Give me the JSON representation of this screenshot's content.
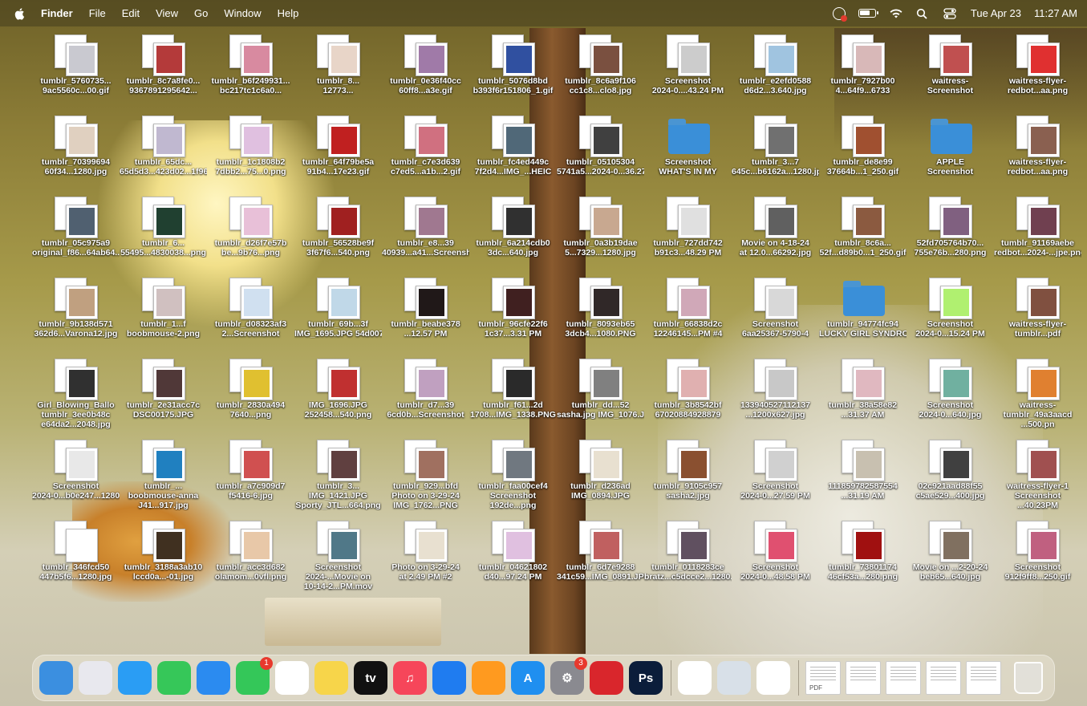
{
  "menubar": {
    "app_name": "Finder",
    "menus": [
      "File",
      "Edit",
      "View",
      "Go",
      "Window",
      "Help"
    ],
    "date": "Tue Apr 23",
    "time": "11:27 AM"
  },
  "desktop": {
    "items": [
      {
        "label": "tumblr_5760735...\n9ac5560c...00.gif",
        "color": "#c9c9d0"
      },
      {
        "label": "tumblr_8c7a8fe0...\n9367891295642...",
        "color": "#b43a3a"
      },
      {
        "label": "tumblr_b6f249931...\nbc217tc1c6a0...",
        "color": "#d88aa0"
      },
      {
        "label": "tumblr_8...\n12773...",
        "color": "#e8d5c8"
      },
      {
        "label": "tumblr_0e36f40cc\n60ff8...a3e.gif",
        "color": "#a07aa8"
      },
      {
        "label": "tumblr_5076d8bd\nb393f6r151806_1.gif",
        "color": "#3050a0"
      },
      {
        "label": "tumblr_8c6a9f106\ncc1c8...clo8.jpg",
        "color": "#7a5040"
      },
      {
        "label": "Screenshot\n2024-0....43.24 PM",
        "color": "#ccc"
      },
      {
        "label": "tumblr_e2efd0588\nd6d2...3.640.jpg",
        "color": "#a0c4e0"
      },
      {
        "label": "tumblr_7927b00\n4...64f9...6733",
        "color": "#d8b8b8"
      },
      {
        "label": "waitress-\nScreenshot",
        "color": "#c05050"
      },
      {
        "label": "waitress-flyer-\nredbot...aa.png",
        "color": "#e03030"
      },
      {
        "label": "tumblr_70399694\n60f34...1280.jpg",
        "color": "#e0d0c0"
      },
      {
        "label": "tumblr_65dc...\n65d5d3...423d02...1f96c.gif",
        "color": "#c0b8d0"
      },
      {
        "label": "tumblr_1c1808b2\n7dbb2...75...0.png",
        "color": "#e0c0e0"
      },
      {
        "label": "tumblr_64f79be5a\n91b4...17e23.gif",
        "color": "#c02020"
      },
      {
        "label": "tumblr_c7e3d639\nc7ed5...a1b...2.gif",
        "color": "#d07080"
      },
      {
        "label": "tumblr_fc4ed449c\n7f2d4...IMG_...HEIC",
        "color": "#506878"
      },
      {
        "label": "tumblr_05105304\n5741a5...2024-0...36.27 PM",
        "color": "#404040"
      },
      {
        "label": "Screenshot\nWHAT'S IN MY",
        "color": "#3a8fd8",
        "folder": true
      },
      {
        "label": "tumblr_3...7\n645c...b6162a...1280.jpg",
        "color": "#707070"
      },
      {
        "label": "tumblr_de8e99\n37664b...1_250.gif",
        "color": "#a05030"
      },
      {
        "label": "APPLE\nScreenshot",
        "color": "#3a8fd8",
        "folder": true
      },
      {
        "label": "waitress-flyer-\nredbot...aa.png",
        "color": "#8a6050"
      },
      {
        "label": "tumblr_05c975a9\noriginal_f86...64ab64...a22c.jpg",
        "color": "#506070"
      },
      {
        "label": "tumblr_6...\n55495...4830038...png",
        "color": "#204030"
      },
      {
        "label": "tumblr_d26f7e57b\nbe...9b76...png",
        "color": "#e8c0d8"
      },
      {
        "label": "tumblr_56528be9f\n3f67f6...540.png",
        "color": "#a02020"
      },
      {
        "label": "tumblr_e8...39\n40939...a41...Screenshot",
        "color": "#a07890"
      },
      {
        "label": "tumblr_6a214cdb0\n3dc...640.jpg",
        "color": "#303030"
      },
      {
        "label": "tumblr_0a3b19dae\n5...7329...1280.jpg",
        "color": "#c8a890"
      },
      {
        "label": "tumblr_727dd742\nb91c3...48.29 PM",
        "color": "#e0e0e0"
      },
      {
        "label": "Movie on 4-18-24\nat 12.0...66292.jpg",
        "color": "#606060"
      },
      {
        "label": "tumblr_8c6a...\n52f...d89b0...1_250.gif",
        "color": "#8b5a40"
      },
      {
        "label": "52fd705764b70...\n755e76b...280.png",
        "color": "#806080"
      },
      {
        "label": "tumblr_91169aebe\nredbot...2024-...jpe.png",
        "color": "#704050"
      },
      {
        "label": "tumblr_9b138d571\n362d6...Varona12.jpg",
        "color": "#c0a080"
      },
      {
        "label": "tumblr_1...f\nboobmouse-2.png",
        "color": "#d0c0c0"
      },
      {
        "label": "tumblr_d08323af3\n2...Screenshot",
        "color": "#d0e0f0"
      },
      {
        "label": "tumblr_69b...3f\nIMG_1695.JPG 54d007...1280.png",
        "color": "#c0d8e8"
      },
      {
        "label": "tumblr_beabe378\n...12.57 PM",
        "color": "#201818"
      },
      {
        "label": "tumblr_96cfe22f6\n1c37...3.31 PM",
        "color": "#402020"
      },
      {
        "label": "tumblr_8093eb65\n3dcb4...1080.PNG",
        "color": "#302828"
      },
      {
        "label": "tumblr_66838d2c\n12246145...PM #4",
        "color": "#d0a8b8"
      },
      {
        "label": "Screenshot\n6aa25367-5790-4",
        "color": "#d8d8d8"
      },
      {
        "label": "tumblr_94774fc94\nLUCKY GIRL SYNDROME",
        "color": "#3a8fd8",
        "folder": true
      },
      {
        "label": "Screenshot\n2024-0...15.24 PM",
        "color": "#b0f070"
      },
      {
        "label": "waitress-flyer-\ntumblr...pdf",
        "color": "#805040"
      },
      {
        "label": "Girl_Blowing_Ballo\ntumblr_3ee0b48c\ne64da2...2048.jpg",
        "color": "#303030"
      },
      {
        "label": "tumblr_2e31acc7c\nDSC00175.JPG",
        "color": "#503838"
      },
      {
        "label": "tumblr_2830a494\n7640...png",
        "color": "#e0c030"
      },
      {
        "label": "IMG_1696.JPG\n252458...540.png",
        "color": "#c03030"
      },
      {
        "label": "tumblr_d7...39\n6cd0b...Screenshot",
        "color": "#c0a0c0"
      },
      {
        "label": "tumblr_f61...2d\n1708...IMG_1338.PNG",
        "color": "#2a2a2a"
      },
      {
        "label": "tumblr_dd...52\nsasha.jpg IMG_1076.JPG",
        "color": "#808080"
      },
      {
        "label": "tumblr_3b8542bf\n67020884928879",
        "color": "#e0b0b0"
      },
      {
        "label": "133940527112137\n...1200x627.jpg",
        "color": "#c8c8c8"
      },
      {
        "label": "tumblr_38a58e82\n...31.37 AM",
        "color": "#e0b8c0"
      },
      {
        "label": "Screenshot\n2024-0...640.jpg",
        "color": "#70b0a0"
      },
      {
        "label": "waitress-\ntumblr_49a3aacd\n...500.pn",
        "color": "#e08030"
      },
      {
        "label": "Screenshot\n2024-0...b0e247...1280.jpg",
        "color": "#e8e8e8"
      },
      {
        "label": "tumblr_...\nboobmouse-anna\nJ41...917.jpg",
        "color": "#2080c0"
      },
      {
        "label": "tumblr_a7c909d7\nf5416-6.jpg",
        "color": "#d05050"
      },
      {
        "label": "tumblr_3...\nIMG_1421.JPG\nSporty_JTL...664.png",
        "color": "#604040"
      },
      {
        "label": "tumblr_929...bfd\nPhoto on 3-29-24\nIMG_1762...PNG",
        "color": "#a07060"
      },
      {
        "label": "tumblr_faa00cef4\nScreenshot\n192de...png",
        "color": "#707880"
      },
      {
        "label": "tumblr_d236ad\nIMG_0894.JPG",
        "color": "#e8e0d0"
      },
      {
        "label": "tumblr_9105c957\nsasha2.jpg",
        "color": "#8a5030"
      },
      {
        "label": "Screenshot\n2024-0...27.59 PM",
        "color": "#d0d0d0"
      },
      {
        "label": "111859782587554\n...31.19 AM",
        "color": "#c8c0b0"
      },
      {
        "label": "02c921aad88f55\nc5ae529...400.jpg",
        "color": "#404040"
      },
      {
        "label": "waitress-flyer-1\nScreenshot\n...40.23PM",
        "color": "#a05050"
      },
      {
        "label": "tumblr_346fcd50\n447b5f6...1280.jpg",
        "color": "#fff"
      },
      {
        "label": "tumblr_3188a3ab10\nlccd0a...-01.jpg",
        "color": "#403020"
      },
      {
        "label": "tumblr_acc3d682\nolamom...0vfl.png",
        "color": "#e8c8a8"
      },
      {
        "label": "Screenshot\n2024-...Movie on\n10-14-2...PM.mov",
        "color": "#507888"
      },
      {
        "label": "Photo on 3-29-24\nat 2.49 PM #2",
        "color": "#e8e0d0"
      },
      {
        "label": "tumblr_04621802\nd40...97.24 PM",
        "color": "#e0c0e0"
      },
      {
        "label": "tumblr_6d7e9288\n341c59...IMG_0891.JPG",
        "color": "#c06060"
      },
      {
        "label": "tumblr_0118283ce\nbratz...c5dcce2...1280.jpg",
        "color": "#605060"
      },
      {
        "label": "Screenshot\n2024-0...48.58 PM",
        "color": "#e05070"
      },
      {
        "label": "tumblr_73801174\n46cf53a...280.png",
        "color": "#a01010"
      },
      {
        "label": "Movie on ...2-20-24\nbeb65...640.jpg",
        "color": "#807060"
      },
      {
        "label": "Screenshot\n912f9ff8...250.gif",
        "color": "#c06080"
      }
    ]
  },
  "dock": {
    "apps": [
      {
        "name": "Finder",
        "glyph": "",
        "color": "#3b8fe0"
      },
      {
        "name": "Launchpad",
        "glyph": "",
        "color": "#e8e8ee"
      },
      {
        "name": "Safari",
        "glyph": "",
        "color": "#2a9df4"
      },
      {
        "name": "Messages",
        "glyph": "",
        "color": "#36c759"
      },
      {
        "name": "Mail",
        "glyph": "",
        "color": "#2b8bf0"
      },
      {
        "name": "FaceTime",
        "glyph": "",
        "color": "#34c759",
        "badge": "1"
      },
      {
        "name": "Reminders",
        "glyph": "",
        "color": "#ffffff"
      },
      {
        "name": "Notes",
        "glyph": "",
        "color": "#f7d54a"
      },
      {
        "name": "TV",
        "glyph": "tv",
        "color": "#111111"
      },
      {
        "name": "Music",
        "glyph": "♫",
        "color": "#f6465a"
      },
      {
        "name": "Keynote",
        "glyph": "",
        "color": "#1f7cf0"
      },
      {
        "name": "Pages",
        "glyph": "",
        "color": "#ff9a1f"
      },
      {
        "name": "App Store",
        "glyph": "A",
        "color": "#1f8ff0"
      },
      {
        "name": "System Settings",
        "glyph": "⚙",
        "color": "#8a8a90",
        "badge": "3"
      },
      {
        "name": "Photo Booth",
        "glyph": "",
        "color": "#d9262c"
      },
      {
        "name": "Photoshop",
        "glyph": "Ps",
        "color": "#0b1d3a"
      }
    ],
    "recent": [
      {
        "name": "Chrome",
        "color": "#ffffff"
      },
      {
        "name": "Preview",
        "color": "#d8e0e8"
      },
      {
        "name": "News",
        "color": "#ffffff"
      }
    ],
    "docs": [
      {
        "tag": "PDF"
      },
      {
        "tag": ""
      },
      {
        "tag": ""
      },
      {
        "tag": ""
      },
      {
        "tag": ""
      }
    ]
  }
}
